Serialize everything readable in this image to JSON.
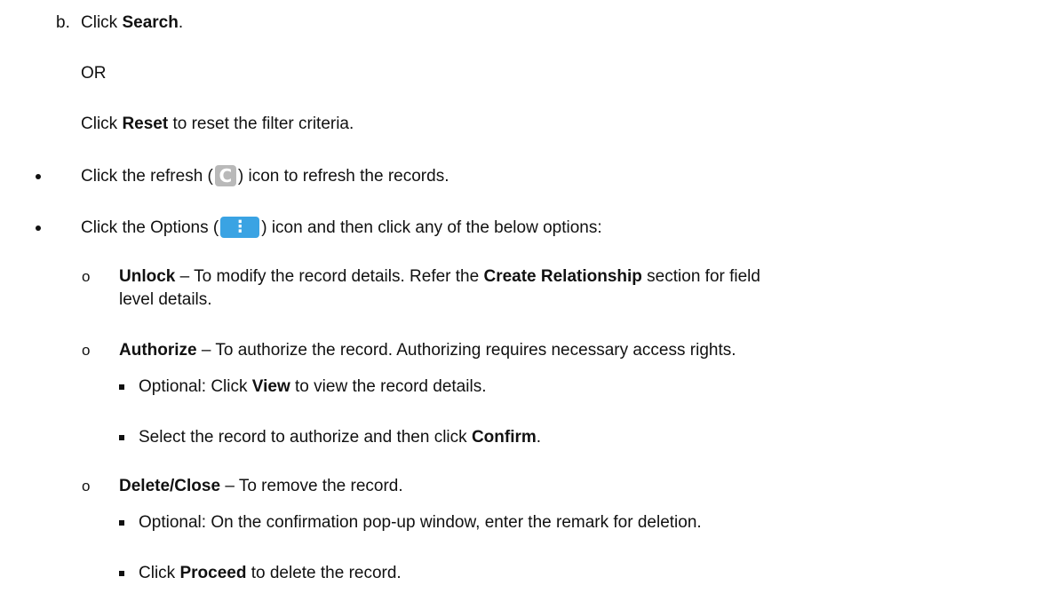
{
  "step_b": {
    "marker": "b.",
    "click": "Click ",
    "search": "Search",
    "end": "."
  },
  "or_text": "OR",
  "reset_line": {
    "click": "Click ",
    "reset": "Reset",
    "rest": " to reset the filter criteria."
  },
  "refresh_bullet": {
    "before": "Click the refresh (",
    "icon_glyph": "C",
    "after": ") icon to refresh the records.",
    "icon": "refresh-icon"
  },
  "options_bullet": {
    "before": "Click the Options (",
    "icon_glyph": "⋮",
    "after": ") icon and then click any of the below options:",
    "icon": "options-icon",
    "icon_color": "#3aa3e3"
  },
  "unlock": {
    "term": "Unlock",
    "dash": " – To modify the record details. Refer the ",
    "ref": "Create Relationship",
    "rest": " section for field",
    "line2": "level details."
  },
  "authorize": {
    "term": "Authorize",
    "rest": " – To authorize the record. Authorizing requires necessary access rights."
  },
  "auth_sub1": {
    "before": "Optional: Click ",
    "bold": "View",
    "after": " to view the record details."
  },
  "auth_sub2": {
    "before": "Select the record to authorize and then click ",
    "bold": "Confirm",
    "after": "."
  },
  "delete": {
    "term": "Delete/Close",
    "rest": " – To remove the record."
  },
  "del_sub1": {
    "text": "Optional: On the confirmation pop-up window, enter the remark for deletion."
  },
  "del_sub2": {
    "before": "Click ",
    "bold": "Proceed",
    "after": " to delete the record."
  }
}
